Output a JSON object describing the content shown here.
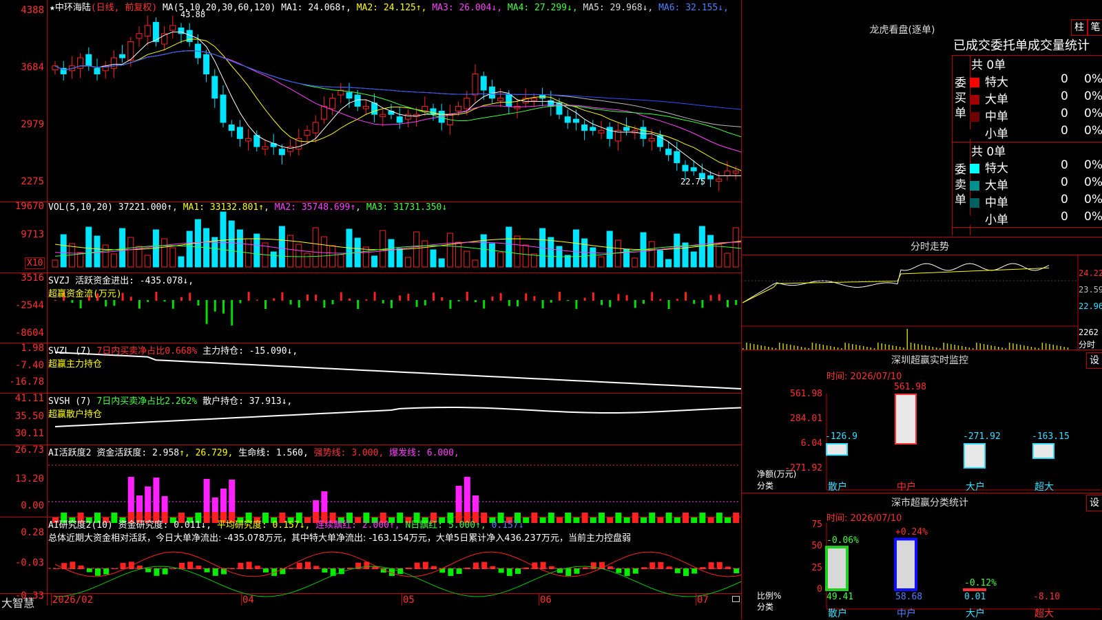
{
  "stock": {
    "name": "中环海陆",
    "mode": "(日线, 前复权)"
  },
  "main_panel": {
    "ma_label": "MA(5,10,20,30,60,120)",
    "ma_values": [
      {
        "name": "MA1",
        "value": "24.068",
        "dir": "↑",
        "color": "#ffffff"
      },
      {
        "name": "MA2",
        "value": "24.125",
        "dir": "↑",
        "color": "#ffff00"
      },
      {
        "name": "MA3",
        "value": "26.004",
        "dir": "↓",
        "color": "#ff40ff"
      },
      {
        "name": "MA4",
        "value": "27.299",
        "dir": "↓",
        "color": "#40ff40"
      },
      {
        "name": "MA5",
        "value": "29.968",
        "dir": "↓",
        "color": "#dddddd"
      },
      {
        "name": "MA6",
        "value": "32.155",
        "dir": "↓",
        "color": "#5080ff"
      }
    ],
    "y_ticks": [
      "4388",
      "3684",
      "2979",
      "2275"
    ],
    "high_mark": "43.88",
    "low_mark": "22.75"
  },
  "vol_panel": {
    "label": "VOL(5,10,20)",
    "value": "37221.000↑",
    "ma1": "MA1: 33132.801↑",
    "ma2": "MA2: 35748.699↑",
    "ma3": "MA3: 31731.350↓",
    "y_ticks": [
      "19670",
      "9713"
    ],
    "unit": "X10"
  },
  "svzj_panel": {
    "label": "SVZJ",
    "text": "活跃资金进出: -435.078↓,",
    "sub": "超赢资金流(万元)",
    "y_ticks": [
      "3516",
      "-2544",
      "-8604"
    ]
  },
  "svzl_panel": {
    "label": "SVZL (7)",
    "ratio": "7日内买卖净占比0.668%",
    "text": "主力持仓: -15.090↓,",
    "sub": "超赢主力持仓",
    "y_ticks": [
      "1.98",
      "-7.40",
      "-16.78"
    ]
  },
  "svsh_panel": {
    "label": "SVSH (7)",
    "ratio": "7日内买卖净占比2.262%",
    "text": "散户持仓: 37.913↓,",
    "sub": "超赢散户持仓",
    "y_ticks": [
      "41.11",
      "35.50",
      "30.11"
    ]
  },
  "ai1_panel": {
    "label": "AI活跃度2",
    "text": "资金活跃度: 2.958",
    "v2": "↑, 26.729,",
    "life": "生命线: 1.560,",
    "strong": "强势线: 3.000,",
    "burst": "爆发线: 6.000,",
    "y_ticks": [
      "26.73",
      "13.20",
      "0.00"
    ]
  },
  "ai2_panel": {
    "label": "AI研究度2(10)",
    "text": "资金研究度: 0.011↓,",
    "avg": "平均研究度: 0.157↓,",
    "cont": "连续飘红: 2.000↑,",
    "n": "N日飘红: 5.000↑,",
    "last": "0.157↓",
    "summary": "总体近期大资金相对活跃，今日大单净流出: -435.078万元，其中特大单净流出: -163.154万元，大单5日累计净入436.237万元，当前主力控盘弱",
    "y_ticks": [
      "0.28",
      "-0.03",
      "-0.33"
    ]
  },
  "x_axis": {
    "labels": [
      "2026/02",
      "04",
      "05",
      "06",
      "07"
    ],
    "brand": "大智慧"
  },
  "right": {
    "lhb_title": "龙虎看盘(逐单)",
    "btn_zhu": "柱",
    "btn_bi": "笔",
    "stats_title": "已成交委托单成交量统计",
    "buy_label": "委买单",
    "sell_label": "委卖单",
    "buy_total": "共 0单",
    "sell_total": "共 0单",
    "buy_rows": [
      {
        "name": "特大",
        "count": "0",
        "pct": "0%",
        "color": "#ff0000"
      },
      {
        "name": "大单",
        "count": "0",
        "pct": "0%",
        "color": "#a00000"
      },
      {
        "name": "中单",
        "count": "0",
        "pct": "0%",
        "color": "#700000"
      },
      {
        "name": "小单",
        "count": "0",
        "pct": "0%",
        "color": "#000000"
      }
    ],
    "sell_rows": [
      {
        "name": "特大",
        "count": "0",
        "pct": "0%",
        "color": "#00ffff"
      },
      {
        "name": "大单",
        "count": "0",
        "pct": "0%",
        "color": "#009090"
      },
      {
        "name": "中单",
        "count": "0",
        "pct": "0%",
        "color": "#006060"
      },
      {
        "name": "小单",
        "count": "0",
        "pct": "0%",
        "color": "#000000"
      }
    ],
    "intraday_title": "分时走势",
    "intraday_ticks": [
      "24.22",
      "23.59",
      "22.96"
    ],
    "intraday_vol": "2262",
    "intraday_vol_label": "分时",
    "sz_title": "深圳超赢实时监控",
    "sz_time": "时间: 2026/07/10",
    "sz_ticks": [
      "561.98",
      "284.01",
      "6.04",
      "-271.92"
    ],
    "sz_net_label": "净额(万元)",
    "sz_cat_label": "分类",
    "sz_values": [
      {
        "cat": "散户",
        "value": "-126.9"
      },
      {
        "cat": "中户",
        "value": "561.98"
      },
      {
        "cat": "大户",
        "value": "-271.92"
      },
      {
        "cat": "超大",
        "value": "-163.15"
      }
    ],
    "sc_title": "深市超赢分类统计",
    "sc_time": "时间: 2026/07/10",
    "sc_ticks": [
      "75",
      "50",
      "25",
      "0"
    ],
    "sc_ratio_label": "比例%",
    "sc_cat_label": "分类",
    "sc_values": [
      {
        "cat": "散户",
        "value": "49.41",
        "change": "-0.06%"
      },
      {
        "cat": "中户",
        "value": "58.68",
        "change": "+0.24%"
      },
      {
        "cat": "大户",
        "value": "0.01",
        "change": "-0.12%"
      },
      {
        "cat": "超大",
        "value": "-8.10",
        "change": ""
      }
    ],
    "set_label": "设"
  },
  "colors": {
    "frame": "#c00000",
    "up": "#ff2020",
    "down": "#00e5ff",
    "bg": "#000000"
  },
  "chart_data": {
    "type": "line",
    "price_close_approx": [
      37,
      36,
      37,
      38,
      37,
      36,
      37,
      38,
      38,
      40,
      41,
      42,
      40,
      41,
      42,
      41,
      40,
      38,
      36,
      33,
      30,
      29,
      28,
      28,
      27,
      27,
      27,
      26,
      27,
      28,
      29,
      30,
      32,
      33,
      34,
      33,
      32,
      32,
      31,
      31,
      31,
      30,
      31,
      31,
      32,
      31,
      30,
      31,
      32,
      33,
      36,
      34,
      33,
      33,
      32,
      32,
      33,
      33,
      33,
      32,
      31,
      30,
      30,
      29,
      29,
      29,
      28,
      29,
      29,
      29,
      28,
      28,
      27,
      26,
      25,
      24,
      24,
      23,
      23,
      23,
      24,
      24,
      23,
      23,
      24
    ]
  }
}
